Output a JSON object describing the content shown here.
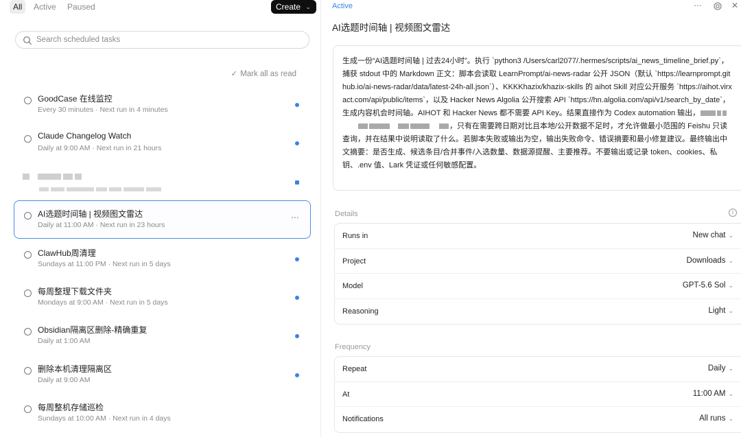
{
  "filters": {
    "all": "All",
    "active": "Active",
    "paused": "Paused"
  },
  "create_label": "Create",
  "search": {
    "placeholder": "Search scheduled tasks"
  },
  "mark_all_read": "Mark all as read",
  "tasks": [
    {
      "name": "GoodCase 在线监控",
      "schedule": "Every 30 minutes · Next run in 4 minutes",
      "unread": true
    },
    {
      "name": "Claude Changelog Watch",
      "schedule": "Daily at 9:00 AM · Next run in 21 hours",
      "unread": true
    },
    {
      "name": "",
      "schedule": "",
      "unread": true,
      "redacted": true
    },
    {
      "name": "AI选题时间轴 | 视频图文雷达",
      "schedule": "Daily at 11:00 AM · Next run in 23 hours",
      "selected": true
    },
    {
      "name": "ClawHub周清理",
      "schedule": "Sundays at 11:00 PM · Next run in 5 days",
      "unread": true
    },
    {
      "name": "每周整理下载文件夹",
      "schedule": "Mondays at 9:00 AM · Next run in 5 days",
      "unread": true
    },
    {
      "name": "Obsidian隔离区删除-精确重复",
      "schedule": "Daily at 1:00 AM",
      "unread": true
    },
    {
      "name": "删除本机清理隔离区",
      "schedule": "Daily at 9:00 AM",
      "unread": true
    },
    {
      "name": "每周整机存储巡检",
      "schedule": "Sundays at 10:00 AM · Next run in 4 days",
      "unread": false
    }
  ],
  "detail": {
    "status": "Active",
    "title": "AI选题时间轴 | 视频图文雷达",
    "prompt_part1": "生成一份“AI选题时间轴 | 过去24小时”。执行 `python3 /Users/carl2077/.hermes/scripts/ai_news_timeline_brief.py`，捕获 stdout 中的 Markdown 正文：脚本会读取 LearnPrompt/ai-news-radar 公开 JSON（默认 `https://learnprompt.github.io/ai-news-radar/data/latest-24h-all.json`）、KKKKhazix/khazix-skills 的 aihot Skill 对应公开服务 `https://aihot.virxact.com/api/public/items`，以及 Hacker News Algolia 公开搜索 API `https://hn.algolia.com/api/v1/search_by_date`，生成内容机会时间轴。AIHOT 和 Hacker News 都不需要 API Key。结果直接作为 Codex automation 输出，",
    "prompt_part2": "，只有在需要跨日期对比且本地/公开数据不足时，才允许做最小范围的 Feishu 只读查询，并在结果中说明读取了什么。若脚本失败或输出为空，输出失败命令、错误摘要和最小修复建议。最终输出中文摘要：是否生成、候选条目/合并事件/入选数量、数据源提醒、主要推荐。不要输出或记录 token、cookies、私钥、.env 值、Lark 凭证或任何敏感配置。",
    "details_label": "Details",
    "details": [
      {
        "key": "Runs in",
        "value": "New chat"
      },
      {
        "key": "Project",
        "value": "Downloads"
      },
      {
        "key": "Model",
        "value": "GPT-5.6 Sol"
      },
      {
        "key": "Reasoning",
        "value": "Light"
      }
    ],
    "frequency_label": "Frequency",
    "frequency": [
      {
        "key": "Repeat",
        "value": "Daily"
      },
      {
        "key": "At",
        "value": "11:00 AM"
      },
      {
        "key": "Notifications",
        "value": "All runs"
      }
    ]
  },
  "icons": {
    "more": "more-icon",
    "archive": "archive-icon",
    "close": "close-icon",
    "info": "info-icon",
    "search": "search-icon"
  },
  "colors": {
    "accent": "#3b82e6",
    "create_bg": "#0f0f0f",
    "selected_border": "#4a8ce8"
  }
}
